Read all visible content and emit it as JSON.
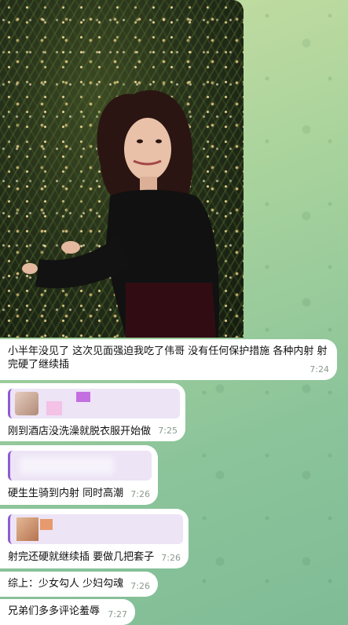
{
  "messages": [
    {
      "text": "小半年没见了 这次见面强迫我吃了伟哥 没有任何保护措施 各种内射 射完硬了继续插",
      "time": "7:24"
    },
    {
      "text": "刚到酒店没洗澡就脱衣服开始做",
      "time": "7:25"
    },
    {
      "text": "硬生生骑到内射 同时高潮",
      "time": "7:26"
    },
    {
      "text": "射完还硬就继续插 要做几把套子",
      "time": "7:26"
    },
    {
      "text": "综上：少女勾人 少妇勾魂",
      "time": "7:26"
    },
    {
      "text": "兄弟们多多评论羞辱",
      "time": "7:27"
    }
  ],
  "colors": {
    "reply_accent": "#8e5bd1",
    "reply_bg": "#ede4f6",
    "bubble": "#ffffff",
    "time": "#8a9a8e"
  }
}
